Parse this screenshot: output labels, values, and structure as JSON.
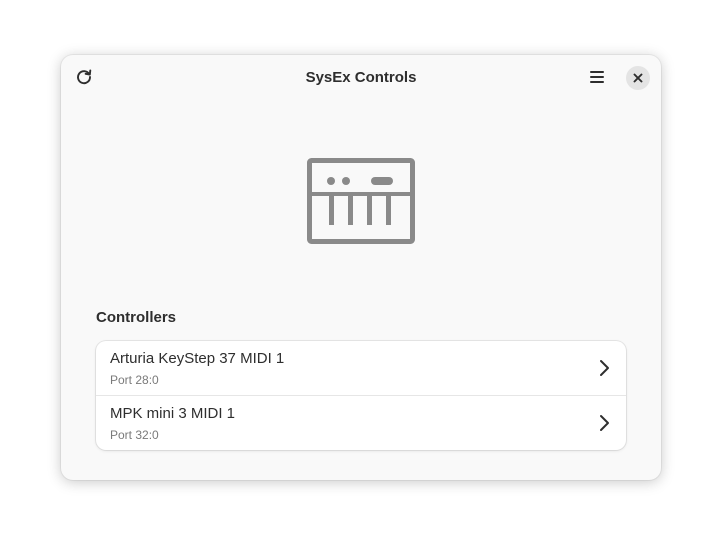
{
  "window": {
    "title": "SysEx Controls"
  },
  "header": {
    "refresh_icon": "view-refresh-icon",
    "menu_icon": "open-menu-icon",
    "close_icon": "window-close-icon"
  },
  "hero": {
    "icon": "midi-keyboard-icon"
  },
  "controllers": {
    "heading": "Controllers",
    "items": [
      {
        "name": "Arturia KeyStep 37 MIDI 1",
        "port": "Port 28:0"
      },
      {
        "name": "MPK mini 3 MIDI 1",
        "port": "Port 32:0"
      }
    ]
  },
  "colors": {
    "window_bg": "#f9f9f9",
    "text": "#2e2e2e",
    "subtext": "#7a7a7a",
    "icon": "#8a8a8a"
  }
}
